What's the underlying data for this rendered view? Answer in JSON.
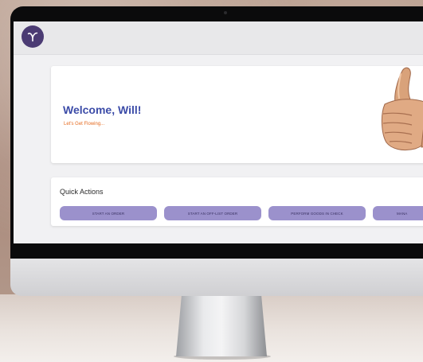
{
  "header": {
    "logo_icon": "brand-swirl-icon",
    "logo_color": "#4b3b73"
  },
  "welcome": {
    "title": "Welcome, Will!",
    "subtitle": "Let's Get Flowing...",
    "title_color": "#3c4ca8",
    "subtitle_color": "#e56a1f",
    "image_icon": "thumbs-up-icon"
  },
  "quick_actions": {
    "title": "Quick Actions",
    "buttons": [
      {
        "label": "START AN ORDER"
      },
      {
        "label": "START AN OFF-LIST ORDER"
      },
      {
        "label": "PERFORM GOODS IN CHECK"
      },
      {
        "label": "MANA"
      }
    ],
    "button_color": "#9b91cc"
  }
}
